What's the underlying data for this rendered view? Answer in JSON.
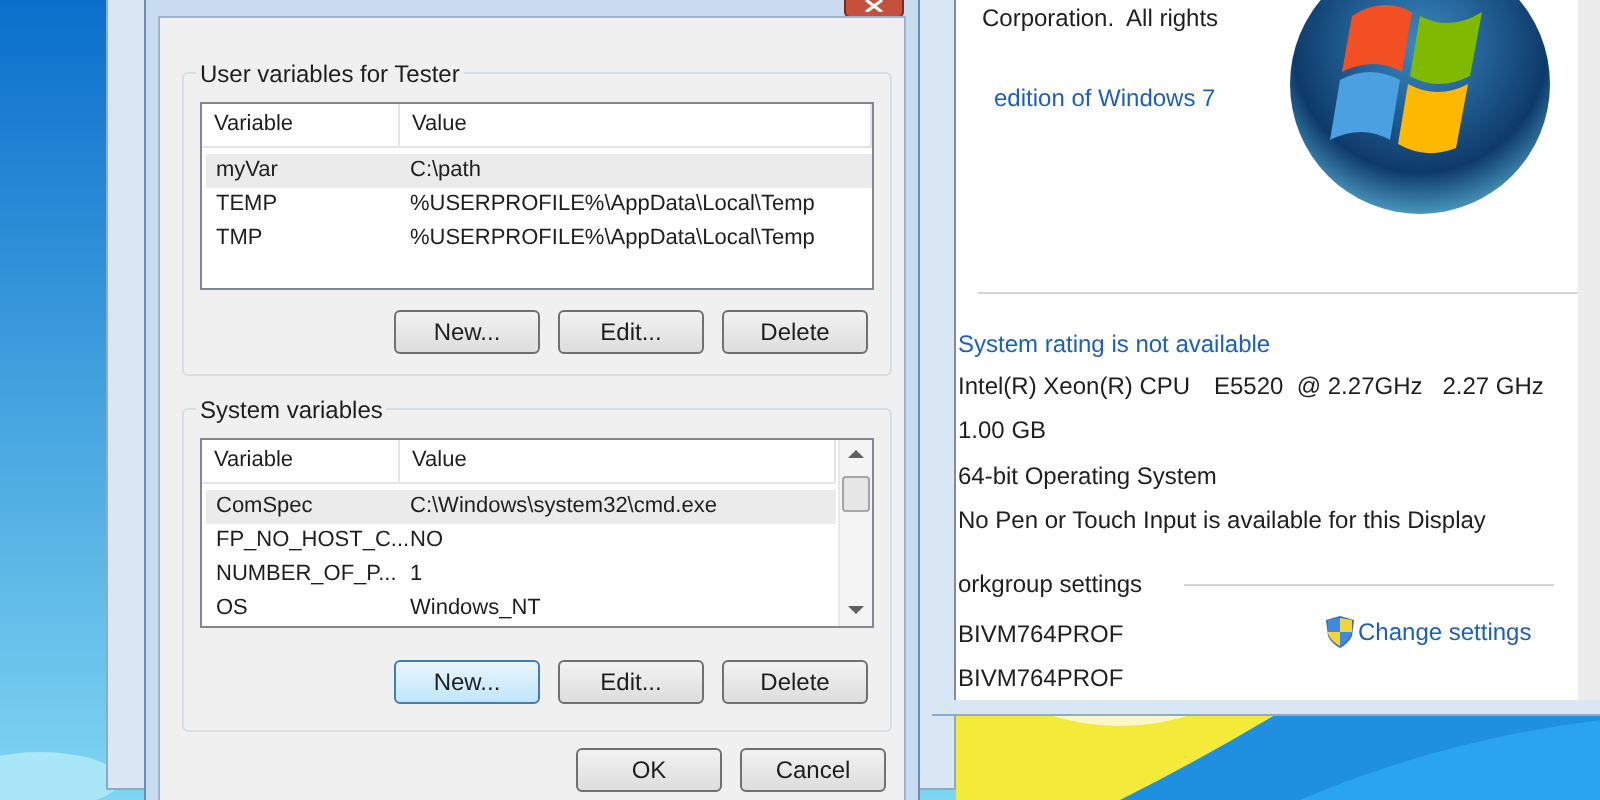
{
  "dialog": {
    "user_variables": {
      "title": "User variables for Tester",
      "columns": [
        "Variable",
        "Value"
      ],
      "rows": [
        {
          "variable": "myVar",
          "value": "C:\\path",
          "selected": true
        },
        {
          "variable": "TEMP",
          "value": "%USERPROFILE%\\AppData\\Local\\Temp",
          "selected": false
        },
        {
          "variable": "TMP",
          "value": "%USERPROFILE%\\AppData\\Local\\Temp",
          "selected": false
        }
      ],
      "buttons": [
        {
          "label": "New...",
          "focused": false
        },
        {
          "label": "Edit...",
          "focused": false
        },
        {
          "label": "Delete",
          "focused": false
        }
      ]
    },
    "system_variables": {
      "title": "System variables",
      "columns": [
        "Variable",
        "Value"
      ],
      "rows": [
        {
          "variable": "ComSpec",
          "value": "C:\\Windows\\system32\\cmd.exe",
          "selected": true
        },
        {
          "variable": "FP_NO_HOST_C...",
          "value": "NO",
          "selected": false
        },
        {
          "variable": "NUMBER_OF_P...",
          "value": "1",
          "selected": false
        },
        {
          "variable": "OS",
          "value": "Windows_NT",
          "selected": false
        }
      ],
      "buttons": [
        {
          "label": "New...",
          "focused": true
        },
        {
          "label": "Edit...",
          "focused": false
        },
        {
          "label": "Delete",
          "focused": false
        }
      ]
    },
    "buttons": [
      "OK",
      "Cancel"
    ]
  },
  "system_window": {
    "copyright": "Corporation.  All rights",
    "edition_link": "edition of Windows 7",
    "rating_link": "System rating is not available",
    "specs": [
      {
        "value": "Intel(R) Xeon(R) CPU",
        "extra": "E5520  @ 2.27GHz   2.27 GHz"
      },
      {
        "value": "1.00 GB"
      },
      {
        "value": "64-bit Operating System"
      },
      {
        "value": "No Pen or Touch Input is available for this Display"
      }
    ],
    "workgroup_heading": "orkgroup settings",
    "names": [
      "BIVM764PROF",
      "BIVM764PROF"
    ],
    "change_settings": "Change settings"
  }
}
